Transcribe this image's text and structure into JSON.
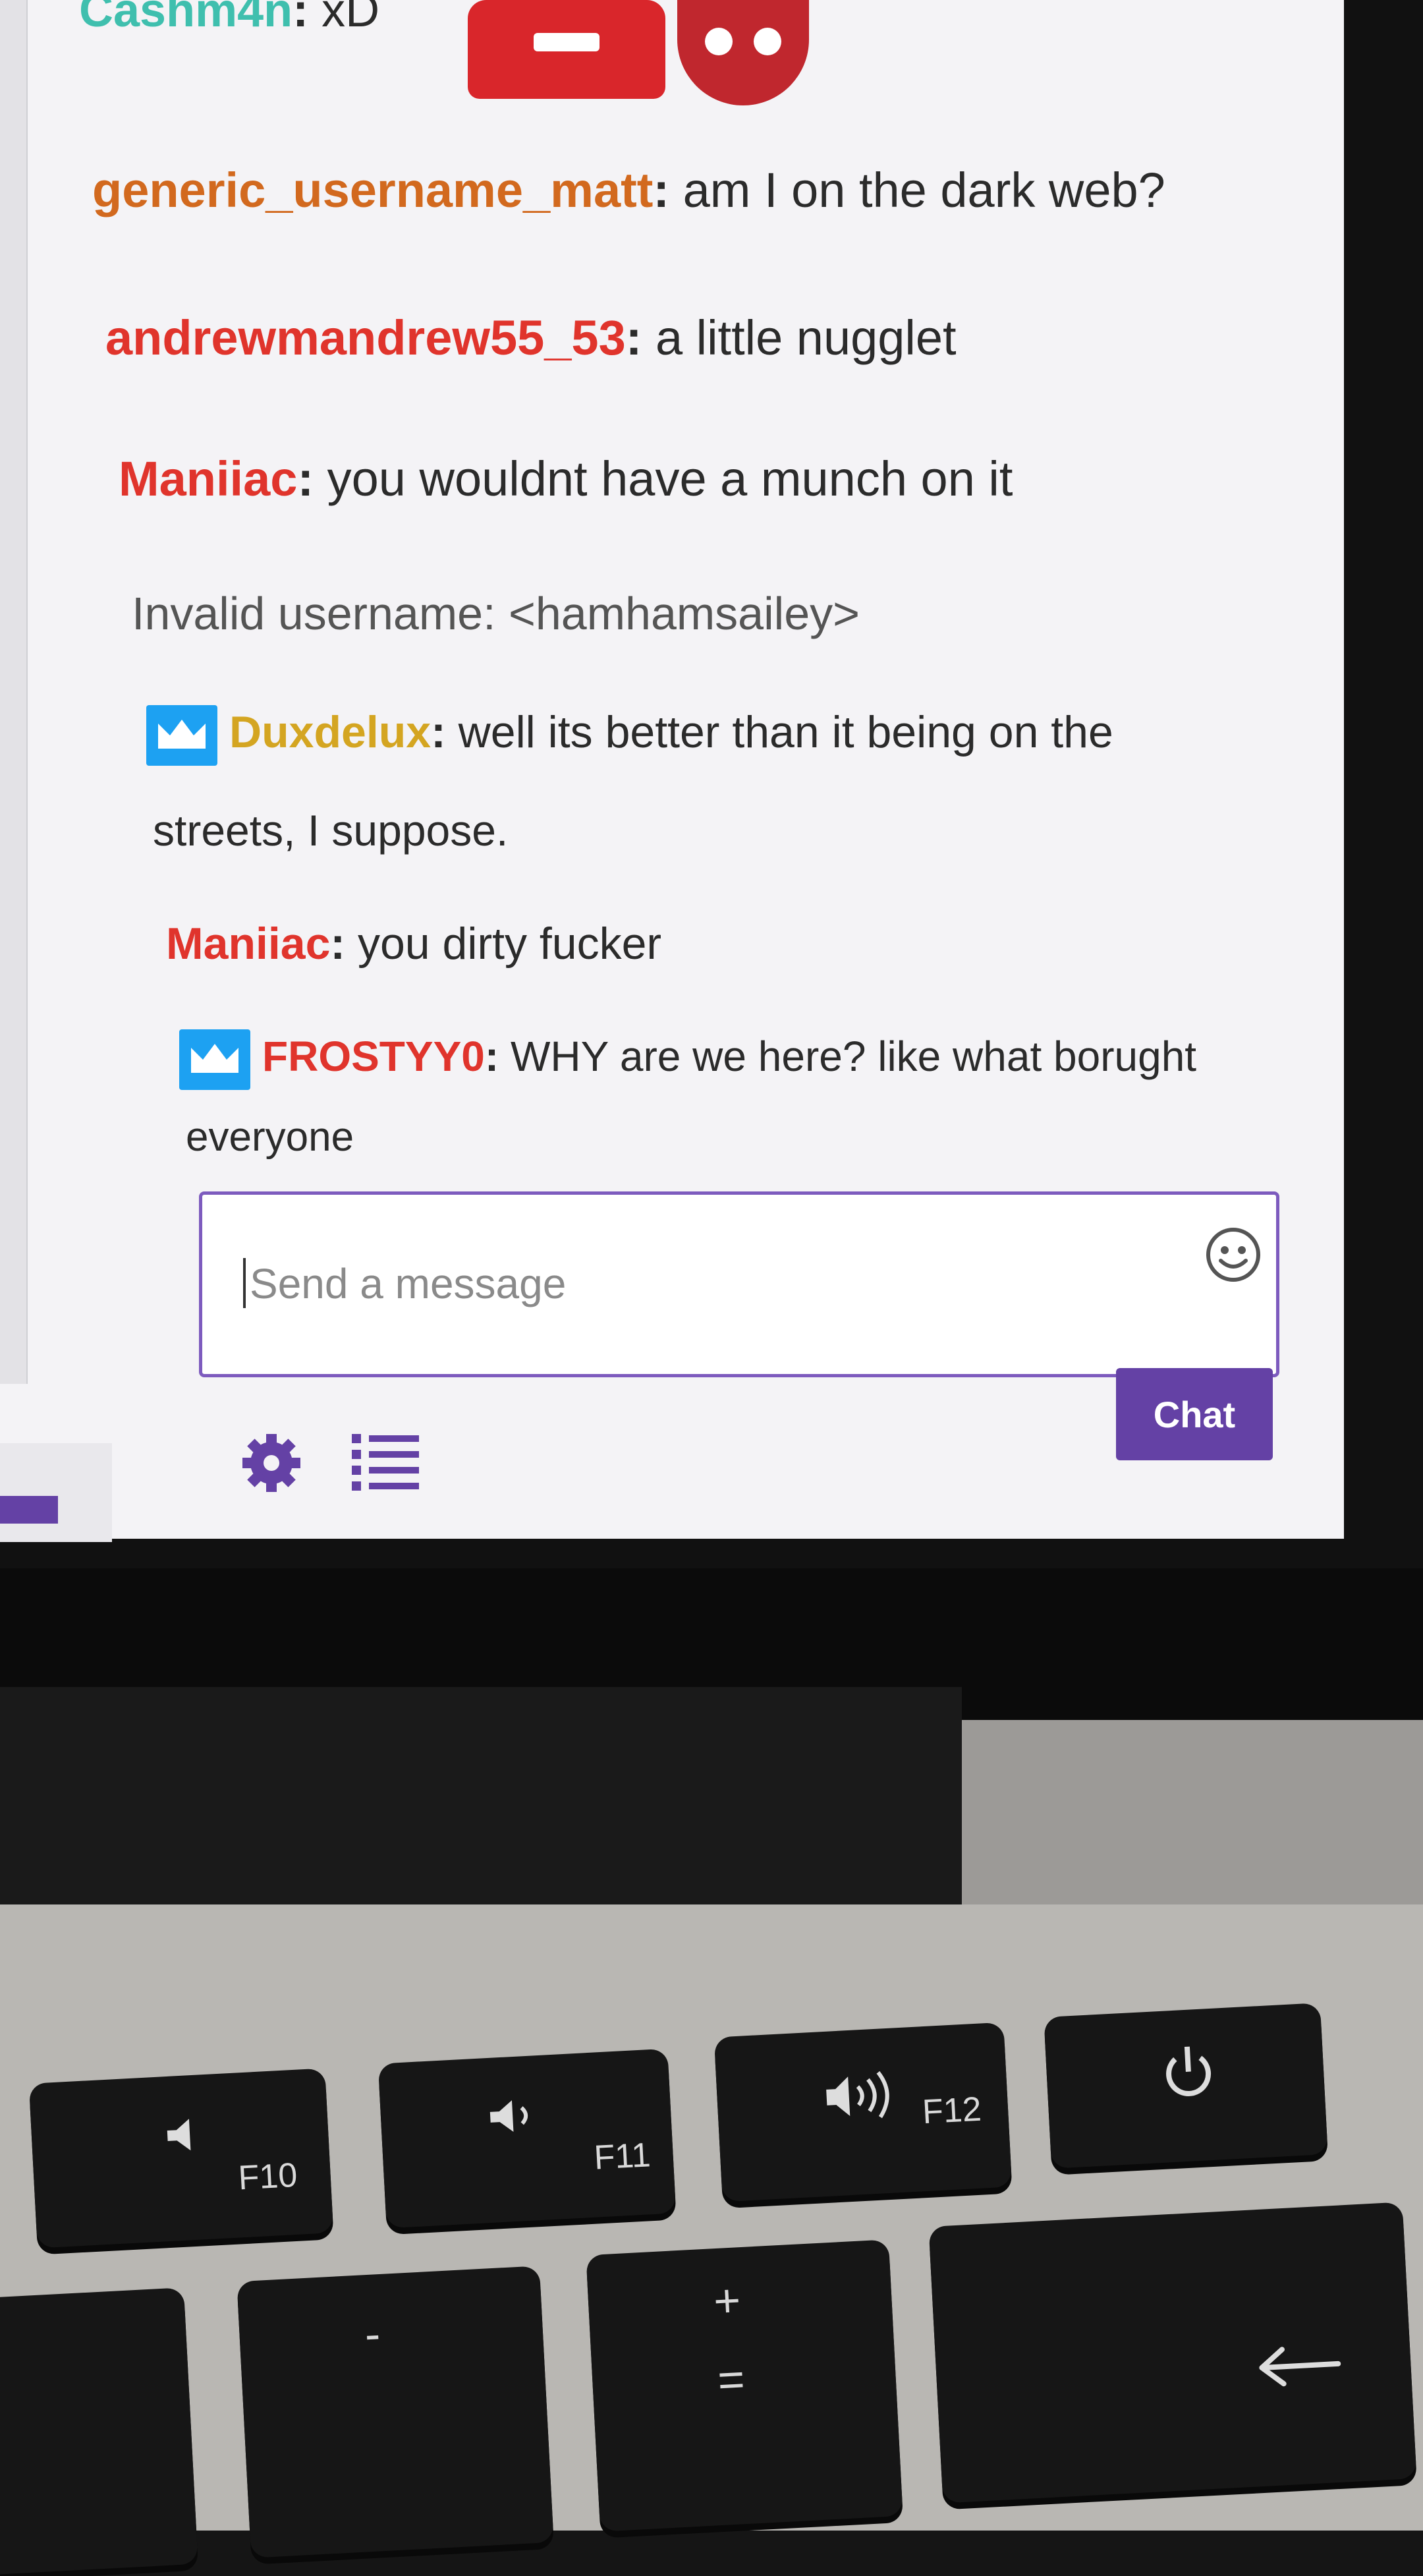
{
  "chat": {
    "messages": [
      {
        "user": "Cashm4n",
        "text": "xD",
        "user_color": "#3fbfae"
      },
      {
        "user": "generic_username_matt",
        "text": "am I on the dark web?",
        "user_color": "#d2691e"
      },
      {
        "user": "andrewmandrew55_53",
        "text": "a little nugglet",
        "user_color": "#e0342c"
      },
      {
        "user": "Maniiac",
        "text": "you wouldnt have a munch on it",
        "user_color": "#e0342c"
      },
      {
        "system": "Invalid username: <hamhamsailey>"
      },
      {
        "user": "Duxdelux",
        "text": "well its better than it being on the",
        "continuation": "streets, I suppose.",
        "user_color": "#d4a521",
        "badge": "crown-badge-icon"
      },
      {
        "user": "Maniiac",
        "text": "you dirty fucker",
        "user_color": "#e0342c"
      },
      {
        "user": "FROSTYY0",
        "text": "WHY are we here? like what borught",
        "continuation": "everyone",
        "user_color": "#e0342c",
        "badge": "crown-badge-icon"
      }
    ],
    "separator": ":",
    "input_placeholder": "Send a message",
    "send_label": "Chat",
    "accent_color": "#6441a5"
  },
  "keyboard": {
    "keys": [
      {
        "label": "F10",
        "icon": "volume-mute-icon"
      },
      {
        "label": "F11",
        "icon": "volume-down-icon"
      },
      {
        "label": "F12",
        "icon": "volume-up-icon"
      },
      {
        "label": "",
        "icon": "power-icon"
      },
      {
        "label": "-",
        "icon": ""
      },
      {
        "label": "+",
        "sub": "="
      },
      {
        "label": "",
        "icon": "delete-arrow-icon"
      }
    ]
  }
}
